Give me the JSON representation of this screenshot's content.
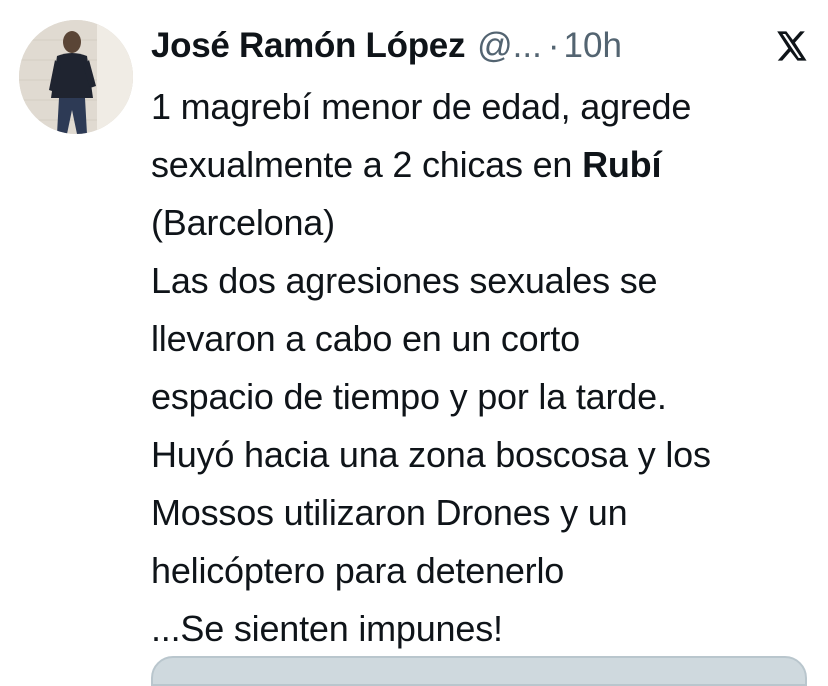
{
  "author": {
    "name": "José Ramón López",
    "handle": "@...",
    "separator": "·",
    "time": "10h",
    "avatar_icon": "user-photo-avatar"
  },
  "platform_icon": "x-logo-icon",
  "tweet": {
    "line1": "1 magrebí menor de edad, agrede",
    "line2_prefix": "sexualmente a 2 chicas en ",
    "line2_bold": "Rubí",
    "line3": "(Barcelona)",
    "line4": "Las dos agresiones sexuales se",
    "line5": "llevaron a cabo en un corto",
    "line6": "espacio de tiempo y por la tarde.",
    "line7": "Huyó hacia una zona boscosa y los",
    "line8": "Mossos utilizaron Drones y un",
    "line9": "helicóptero para detenerlo",
    "line10": "...Se sienten impunes!"
  },
  "colors": {
    "text": "#0f1419",
    "secondary": "#536471",
    "card_border": "#cfd9de"
  }
}
